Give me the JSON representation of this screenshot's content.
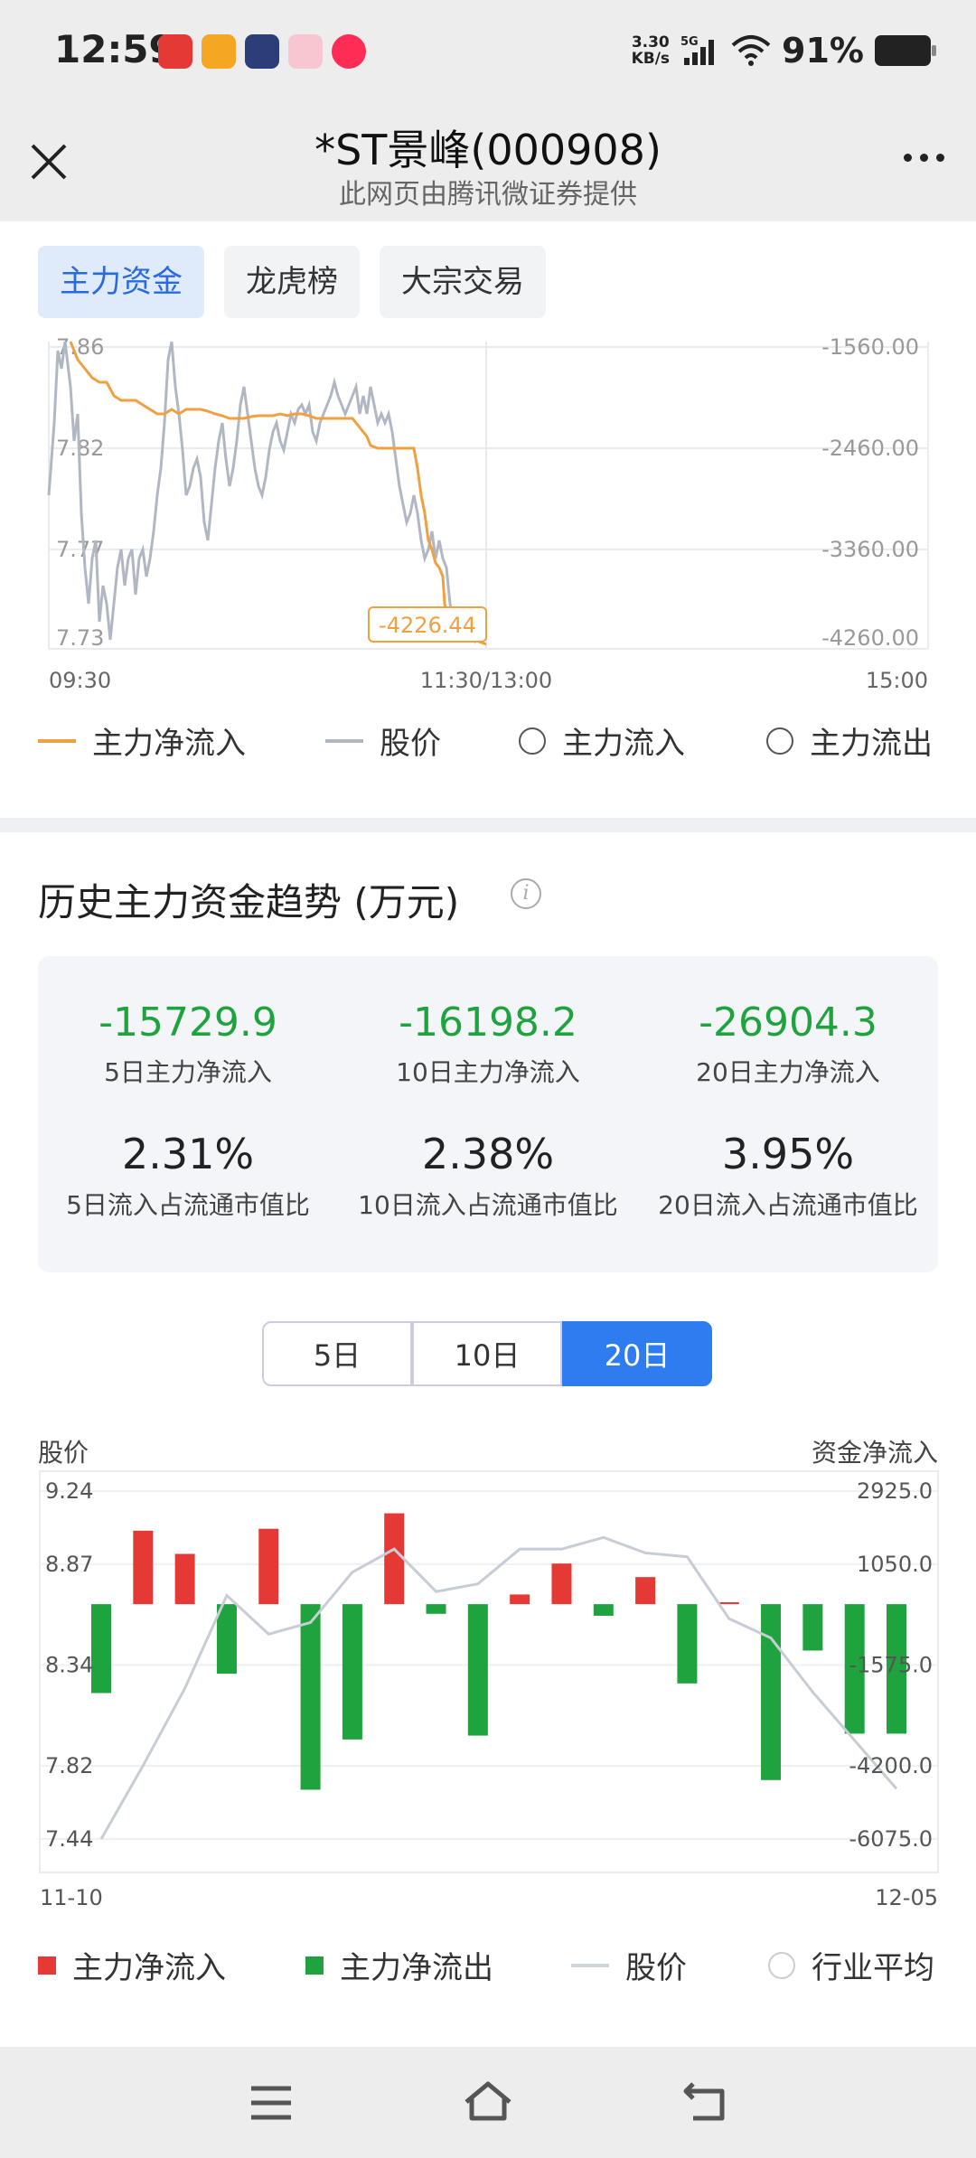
{
  "status_bar": {
    "time": "12:59",
    "speed_top": "3.30",
    "speed_bottom": "KB/s",
    "network": "5G",
    "battery": "91%"
  },
  "header": {
    "title": "*ST景峰(000908)",
    "subtitle": "此网页由腾讯微证券提供"
  },
  "tabs": [
    {
      "label": "主力资金",
      "active": true
    },
    {
      "label": "龙虎榜",
      "active": false
    },
    {
      "label": "大宗交易",
      "active": false
    }
  ],
  "intraday_chart": {
    "left_ticks": [
      "7.86",
      "7.82",
      "7.77",
      "7.73"
    ],
    "right_ticks": [
      "-1560.00",
      "-2460.00",
      "-3360.00",
      "-4260.00"
    ],
    "x_ticks": [
      "09:30",
      "11:30/13:00",
      "15:00"
    ],
    "tooltip": "-4226.44",
    "legend": [
      "主力净流入",
      "股价",
      "主力流入",
      "主力流出"
    ]
  },
  "history": {
    "title": "历史主力资金趋势 (万元)",
    "stats": [
      {
        "value": "-15729.9",
        "label": "5日主力净流入"
      },
      {
        "value": "-16198.2",
        "label": "10日主力净流入"
      },
      {
        "value": "-26904.3",
        "label": "20日主力净流入"
      },
      {
        "value": "2.31%",
        "label": "5日流入占流通市值比"
      },
      {
        "value": "2.38%",
        "label": "10日流入占流通市值比"
      },
      {
        "value": "3.95%",
        "label": "20日流入占流通市值比"
      }
    ],
    "periods": [
      {
        "label": "5日",
        "active": false
      },
      {
        "label": "10日",
        "active": false
      },
      {
        "label": "20日",
        "active": true
      }
    ],
    "left_axis_title": "股价",
    "right_axis_title": "资金净流入",
    "legend": [
      "主力净流入",
      "主力净流出",
      "股价",
      "行业平均"
    ]
  },
  "colors": {
    "accent": "#2f7cf0",
    "inflow": "#e53935",
    "outflow": "#1fa33e",
    "flow_line": "#f0a040",
    "price_line": "#b0b7c3"
  },
  "chart_data": {
    "type": "bar",
    "x_range_labels": [
      "11-10",
      "12-05"
    ],
    "left_ticks": [
      "9.24",
      "8.87",
      "8.34",
      "7.82",
      "7.44"
    ],
    "right_ticks": [
      "2925.0",
      "1050.0",
      "-1575.0",
      "-4200.0",
      "-6075.0"
    ],
    "ylim_flow": [
      -6075,
      2925
    ],
    "ylim_price": [
      7.44,
      9.24
    ],
    "series": [
      {
        "name": "主力净流入/主力净流出",
        "values": [
          -2300,
          1900,
          1300,
          -1800,
          1950,
          -4800,
          -3500,
          2350,
          -250,
          -3400,
          250,
          1050,
          -300,
          700,
          -2050,
          50,
          -4550,
          -1200,
          -3350,
          -3350
        ]
      },
      {
        "name": "股价",
        "values": [
          7.44,
          7.82,
          8.22,
          8.7,
          8.5,
          8.56,
          8.82,
          8.94,
          8.72,
          8.76,
          8.94,
          8.94,
          9.0,
          8.92,
          8.9,
          8.58,
          8.48,
          8.2,
          7.95,
          7.7
        ]
      }
    ]
  }
}
